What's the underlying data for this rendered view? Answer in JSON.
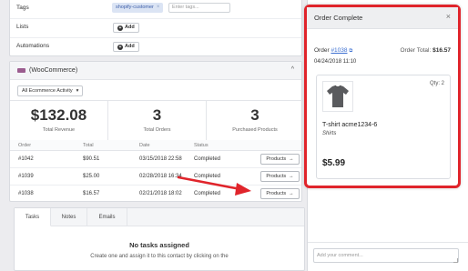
{
  "properties": {
    "tags_label": "Tags",
    "tag_chip": "shopify-customer",
    "tag_chip_remove": "×",
    "tag_placeholder": "Enter tags...",
    "lists_label": "Lists",
    "automations_label": "Automations",
    "add_label": "Add",
    "add_icon": "+"
  },
  "woocommerce": {
    "title": "(WooCommerce)",
    "chevron": "^",
    "filter": "All Ecommerce Activity",
    "filter_icon": "▾",
    "stats": [
      {
        "value": "$132.08",
        "label": "Total Revenue"
      },
      {
        "value": "3",
        "label": "Total Orders"
      },
      {
        "value": "3",
        "label": "Purchased Products"
      }
    ],
    "columns": [
      "Order",
      "Total",
      "Date",
      "Status"
    ],
    "orders": [
      {
        "order": "#1042",
        "total": "$90.51",
        "date": "03/15/2018 22:58",
        "status": "Completed",
        "button": "Products",
        "arrow": "→"
      },
      {
        "order": "#1039",
        "total": "$25.00",
        "date": "02/28/2018 16:34",
        "status": "Completed",
        "button": "Products",
        "arrow": "→"
      },
      {
        "order": "#1038",
        "total": "$16.57",
        "date": "02/21/2018 18:02",
        "status": "Completed",
        "button": "Products",
        "arrow": "→"
      }
    ]
  },
  "tabs": {
    "items": [
      "Tasks",
      "Notes",
      "Emails"
    ],
    "empty_title": "No tasks assigned",
    "empty_text": "Create one and assign it to this contact by clicking on the"
  },
  "modal": {
    "title": "Order Complete",
    "close": "×",
    "order_label": "Order",
    "order_link": "#1038",
    "external_icon": "⧉",
    "order_total_label": "Order Total:",
    "order_total_value": "$16.57",
    "date": "04/24/2018 11:10",
    "qty": "Qty: 2",
    "product_name": "T-shirt acme1234-6",
    "product_category": "Shirts",
    "product_price": "$5.99"
  },
  "comment": {
    "placeholder": "Add your comment..."
  },
  "colors": {
    "annotation_red": "#e0242b",
    "brand_purple": "#9b5c8f",
    "link_blue": "#3b6fd1"
  }
}
